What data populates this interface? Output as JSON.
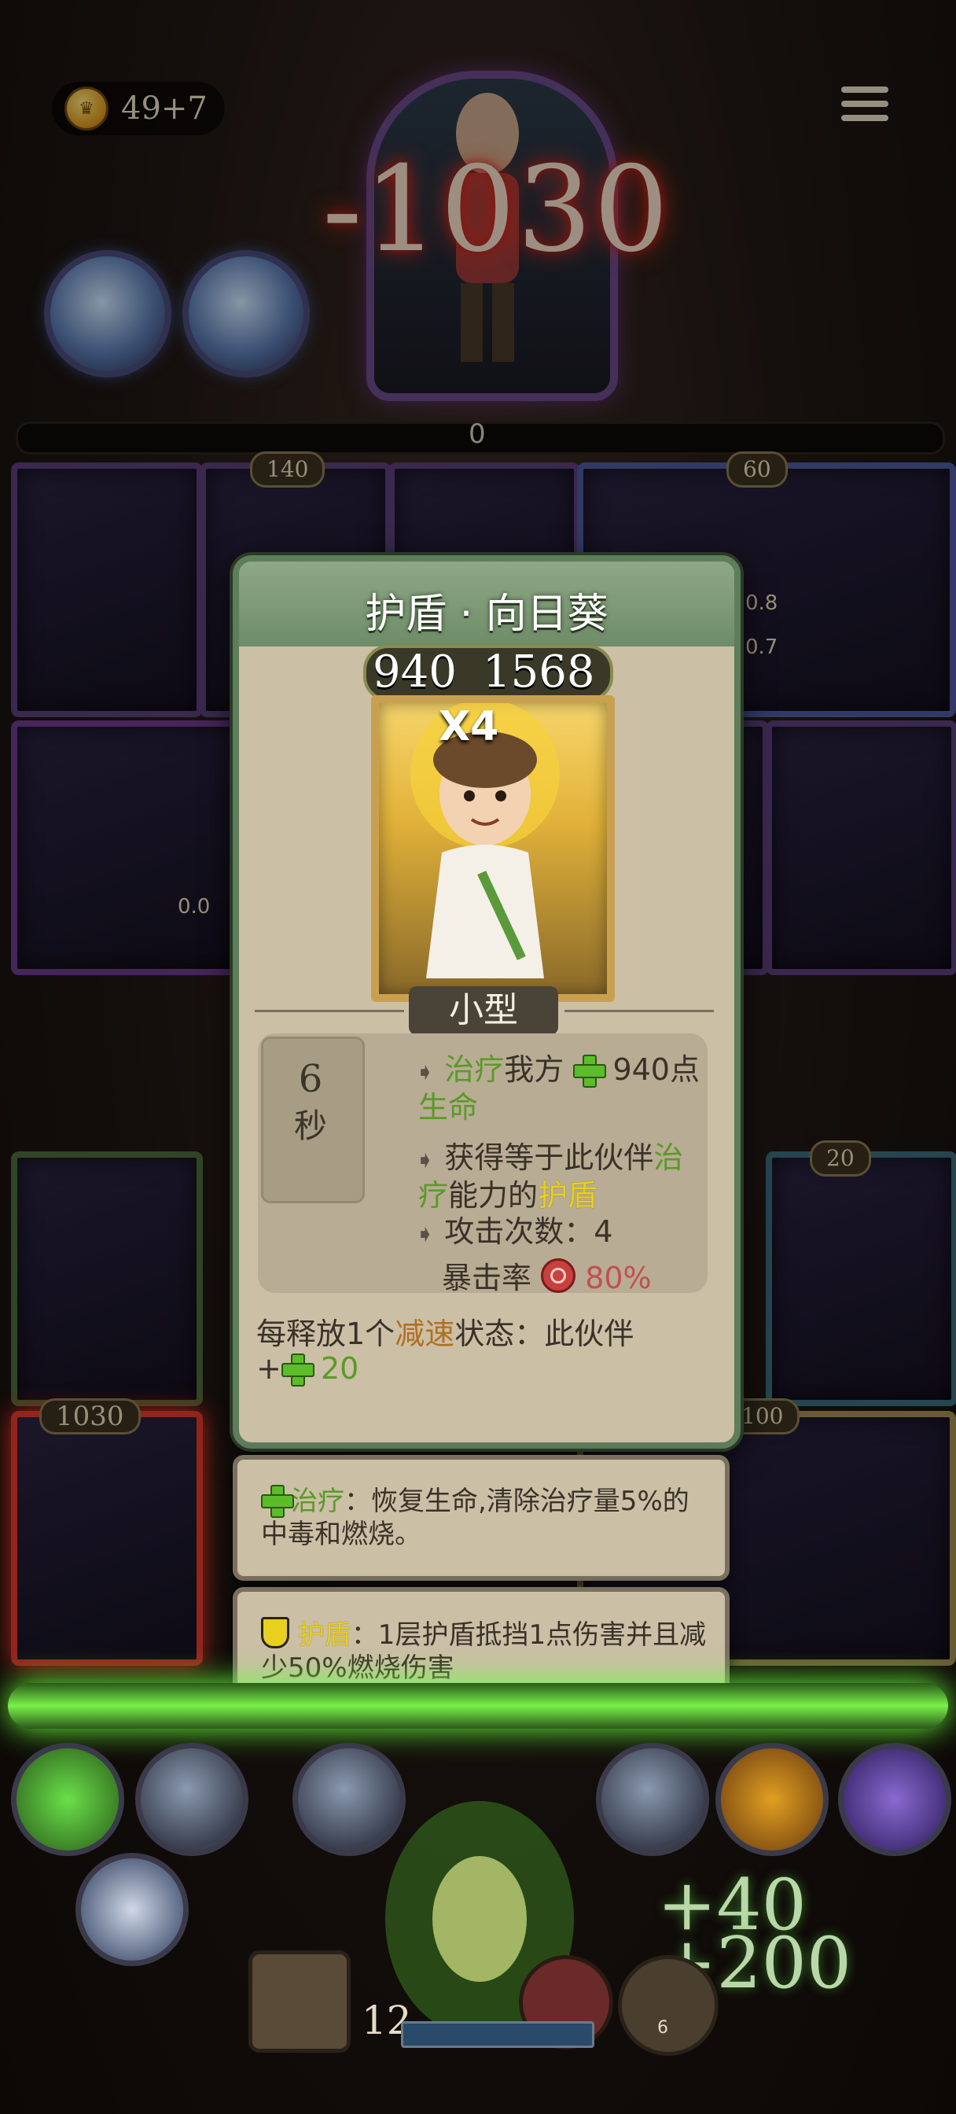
{
  "hud": {
    "coins": "49+7",
    "coin_icon": "coin-icon",
    "menu_icon": "menu-icon"
  },
  "enemy": {
    "damage": "-1030"
  },
  "board": {
    "bar_value": "0",
    "badges": {
      "top_left": "140",
      "top_right": "60",
      "right_mid": "20",
      "left_bottom": "1030",
      "right_bottom": "100"
    },
    "card_values": {
      "a": "0.8",
      "b": "0.7",
      "c": "0.0"
    }
  },
  "popup": {
    "title": "护盾 · 向日葵",
    "stat_heal": "940",
    "stat_shield": "1568",
    "multiplier": "X4",
    "size": "小型",
    "timer_value": "6",
    "timer_unit": "秒",
    "line1_heal": "治疗",
    "line1_mid": "我方",
    "line1_value": "940点",
    "line1_tail": "生命",
    "line2_a": "获得等于此伙伴",
    "line2_heal_a": "治",
    "line2_heal_b": "疗",
    "line2_mid": "能力的",
    "line2_shield": "护盾",
    "attack_label": "攻击次数：",
    "attack_value": "4",
    "crit_label": "暴击率",
    "crit_value": "80%",
    "passive_a": "每释放1个",
    "passive_slow": "减速",
    "passive_b": "状态：此伙伴",
    "passive_plus": "+",
    "passive_value": "20"
  },
  "tooltips": {
    "heal_name": "治疗",
    "heal_text_a": "：恢复生命,清除治疗量5%的",
    "heal_text_b": "中毒和燃烧。",
    "shield_name": "护盾",
    "shield_text_a": "：1层护盾抵挡1点伤害并且减",
    "shield_text_b": "少50%燃烧伤害"
  },
  "bottom": {
    "gain_a": "+40",
    "gain_b": "+200",
    "level": "12",
    "trophy_count": "6"
  },
  "colors": {
    "heal": "#5a9a28",
    "shield": "#e8d020",
    "slow": "#b07020",
    "crit": "#c25050",
    "popup_bg": "#cbbfa6",
    "popup_border": "#5e7d5a"
  }
}
